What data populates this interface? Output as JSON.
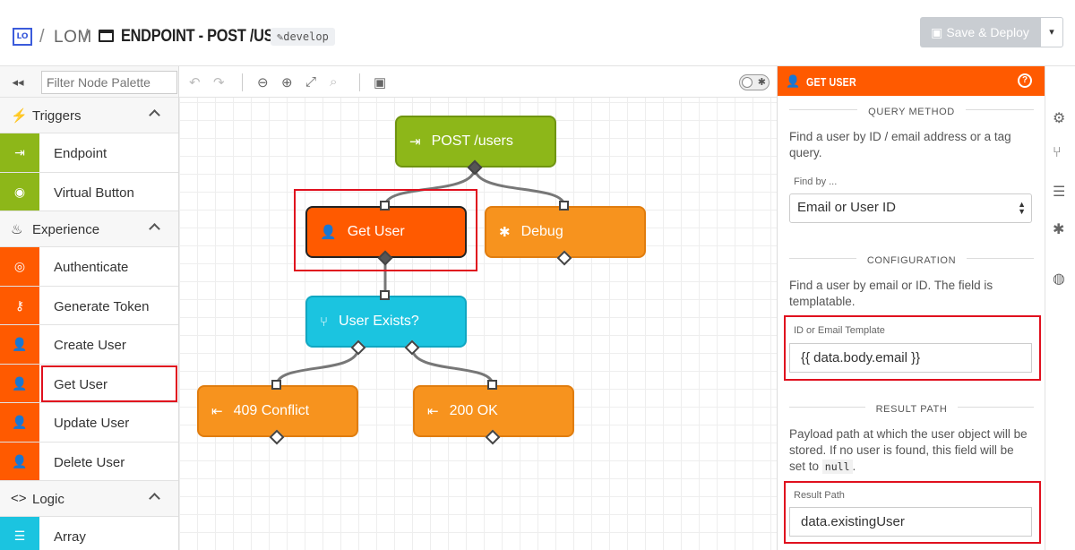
{
  "header": {
    "logo": "LO",
    "sep1": "/",
    "project": "LOM",
    "sep2": "/",
    "title": "ENDPOINT - POST /USERS",
    "branch": "develop",
    "deploy_label": "Save & Deploy",
    "deploy_caret": "▾"
  },
  "palette": {
    "collapse_icon": "◂◂",
    "filter_placeholder": "Filter Node Palette",
    "categories": [
      {
        "label": "Triggers",
        "icon": "⚡",
        "items": [
          {
            "label": "Endpoint",
            "icon": "⇥",
            "color": "#8db719"
          },
          {
            "label": "Virtual Button",
            "icon": "◉",
            "color": "#8db719"
          }
        ]
      },
      {
        "label": "Experience",
        "icon": "♨",
        "items": [
          {
            "label": "Authenticate",
            "icon": "◎",
            "color": "#ff5a00"
          },
          {
            "label": "Generate Token",
            "icon": "⚷",
            "color": "#ff5a00"
          },
          {
            "label": "Create User",
            "icon": "👤",
            "color": "#ff5a00"
          },
          {
            "label": "Get User",
            "icon": "👤",
            "color": "#ff5a00"
          },
          {
            "label": "Update User",
            "icon": "👤",
            "color": "#ff5a00"
          },
          {
            "label": "Delete User",
            "icon": "👤",
            "color": "#ff5a00"
          }
        ]
      },
      {
        "label": "Logic",
        "icon": "<>",
        "items": [
          {
            "label": "Array",
            "icon": "☰",
            "color": "#1bc4e0"
          }
        ]
      }
    ]
  },
  "canvas": {
    "nodes": {
      "post_users": "POST /users",
      "get_user": "Get User",
      "debug": "Debug",
      "user_exists": "User Exists?",
      "conflict": "409 Conflict",
      "ok": "200 OK"
    }
  },
  "panel": {
    "title": "GET USER",
    "help": "?",
    "query_method": {
      "heading": "QUERY METHOD",
      "description": "Find a user by ID / email address or a tag query.",
      "find_by_label": "Find by ...",
      "find_by_value": "Email or User ID"
    },
    "configuration": {
      "heading": "CONFIGURATION",
      "description": "Find a user by email or ID. The field is templatable.",
      "template_label": "ID or Email Template",
      "template_value": "{{ data.body.email }}"
    },
    "result_path": {
      "heading": "RESULT PATH",
      "description_before": "Payload path at which the user object will be stored. If no user is found, this field will be set to",
      "description_code": "null",
      "description_after": ".",
      "label": "Result Path",
      "value": "data.existingUser"
    }
  },
  "colors": {
    "accent": "#ff5a00",
    "trigger": "#8db719",
    "logic": "#1bc4e0",
    "output": "#f7931e",
    "highlight": "#e0101e"
  }
}
